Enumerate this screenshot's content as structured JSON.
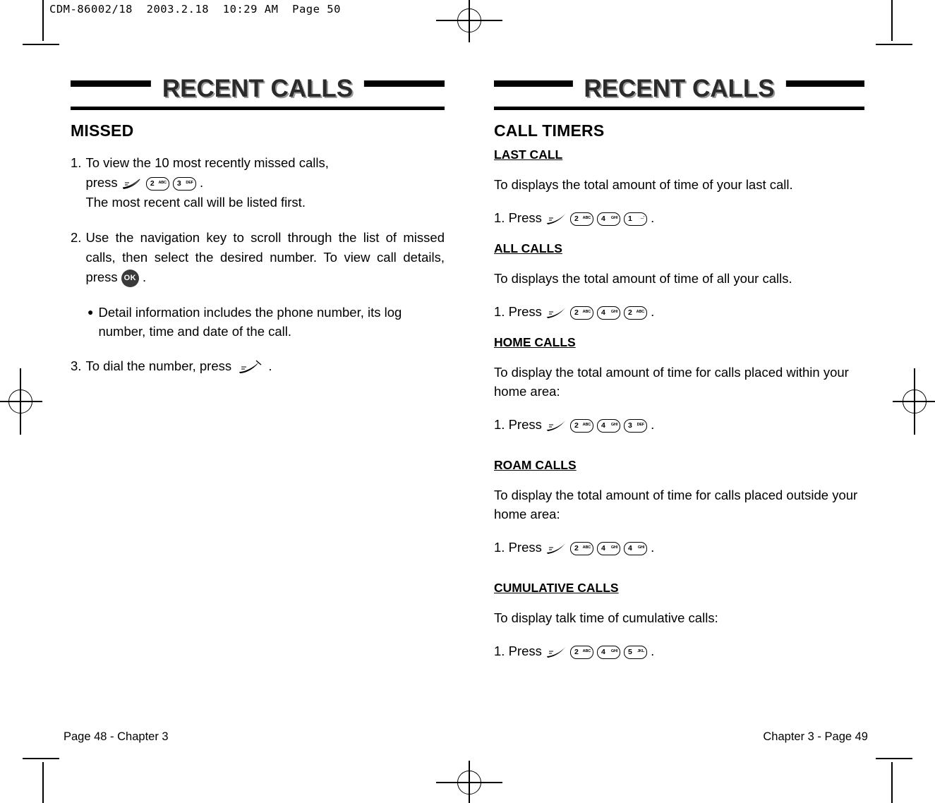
{
  "slug": "CDM-86002/18  2003.2.18  10:29 AM  Page 50",
  "left_page": {
    "banner_title": "RECENT CALLS",
    "section_heading": "MISSED",
    "steps": [
      {
        "num": "1.",
        "line1": "To view the 10 most recently missed calls,",
        "line2_prefix": "press",
        "keys": [
          "send",
          "2ABC",
          "3DEF"
        ],
        "line2_suffix": ".",
        "line3": "The most recent call will be listed first."
      },
      {
        "num": "2.",
        "text_a": "Use the navigation key to scroll through the list of missed calls, then select the desired number. To view call details, press",
        "key": "OK",
        "text_b": "."
      },
      {
        "num": "3.",
        "text_a": "To dial the number, press",
        "key": "end",
        "text_b": "."
      }
    ],
    "bullet": "Detail information includes the phone number, its log number, time and date of the call.",
    "footer": "Page 48 - Chapter 3"
  },
  "right_page": {
    "banner_title": "RECENT CALLS",
    "section_heading": "CALL TIMERS",
    "blocks": [
      {
        "title": "LAST CALL",
        "body": "To displays the total amount of time of your last call.",
        "press_label": "1. Press",
        "keys": [
          "send",
          "2ABC",
          "4GHI",
          "1"
        ],
        "period": "."
      },
      {
        "title": "ALL CALLS",
        "body": "To displays the total amount of time of all your calls.",
        "press_label": "1. Press",
        "keys": [
          "send",
          "2ABC",
          "4GHI",
          "2ABC"
        ],
        "period": "."
      },
      {
        "title": "HOME CALLS",
        "body": "To display the total amount of time for calls placed within your home area:",
        "press_label": "1. Press",
        "keys": [
          "send",
          "2ABC",
          "4GHI",
          "3DEF"
        ],
        "period": "."
      },
      {
        "title": "ROAM CALLS",
        "body": "To display the total amount of time for calls placed outside your home area:",
        "press_label": "1. Press",
        "keys": [
          "send",
          "2ABC",
          "4GHI",
          "4GHI"
        ],
        "period": "."
      },
      {
        "title": "CUMULATIVE CALLS",
        "body": "To display talk time of cumulative calls:",
        "press_label": "1. Press",
        "keys": [
          "send",
          "2ABC",
          "4GHI",
          "5JKL"
        ],
        "period": "."
      }
    ],
    "footer": "Chapter 3 - Page 49"
  },
  "keycaps": {
    "1": {
      "digit": "1",
      "sub": "...'"
    },
    "2ABC": {
      "digit": "2",
      "sub": "ABC"
    },
    "3DEF": {
      "digit": "3",
      "sub": "DEF"
    },
    "4GHI": {
      "digit": "4",
      "sub": "GHI"
    },
    "5JKL": {
      "digit": "5",
      "sub": "JKL"
    }
  },
  "colors": {
    "ink": "#000000",
    "title_fill": "#2b2b2b",
    "title_shadow": "#9a9a9a",
    "ok_key": "#3a3a3a"
  }
}
